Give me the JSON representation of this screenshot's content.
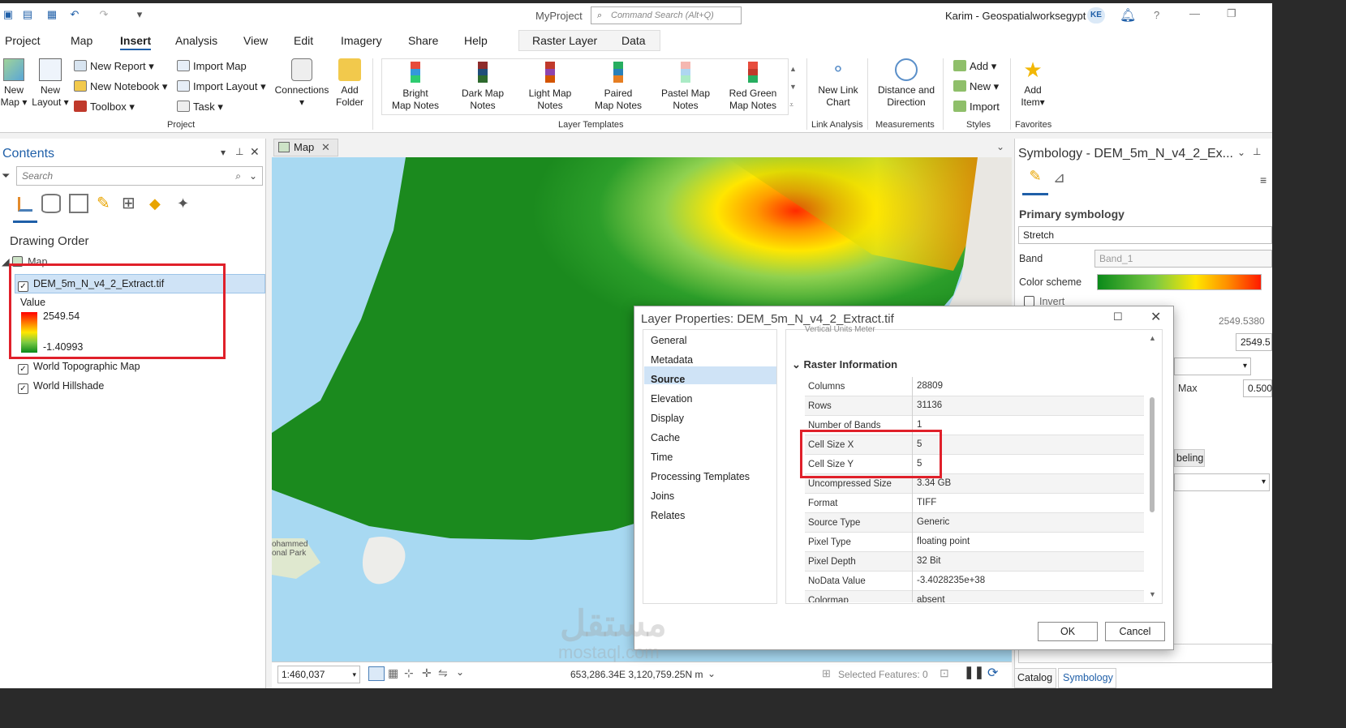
{
  "title_bar": {
    "project": "MyProject",
    "command_search_placeholder": "Command Search (Alt+Q)",
    "user": "Karim - Geospatialworksegypt",
    "user_initials": "KE",
    "help": "?"
  },
  "menu": {
    "tabs": [
      "Project",
      "Map",
      "Insert",
      "Analysis",
      "View",
      "Edit",
      "Imagery",
      "Share",
      "Help"
    ],
    "active": "Insert",
    "context_tabs": [
      "Raster Layer",
      "Data"
    ]
  },
  "ribbon": {
    "new_map": [
      "New",
      "Map"
    ],
    "new_layout": [
      "New",
      "Layout"
    ],
    "new_report": "New Report",
    "new_notebook": "New Notebook",
    "toolbox": "Toolbox",
    "import_map": "Import Map",
    "import_layout": "Import Layout",
    "task": "Task",
    "connections": "Connections",
    "add_folder": [
      "Add",
      "Folder"
    ],
    "project_group": "Project",
    "templates": [
      {
        "line1": "Bright",
        "line2": "Map Notes"
      },
      {
        "line1": "Dark Map",
        "line2": "Notes"
      },
      {
        "line1": "Light Map",
        "line2": "Notes"
      },
      {
        "line1": "Paired",
        "line2": "Map Notes"
      },
      {
        "line1": "Pastel Map",
        "line2": "Notes"
      },
      {
        "line1": "Red Green",
        "line2": "Map Notes"
      }
    ],
    "templates_group": "Layer Templates",
    "new_link_chart": [
      "New Link",
      "Chart"
    ],
    "link_analysis_group": "Link Analysis",
    "distance_direction": [
      "Distance and",
      "Direction"
    ],
    "measurements_group": "Measurements",
    "styles_add": "Add",
    "styles_new": "New",
    "styles_import": "Import",
    "styles_group": "Styles",
    "add_item": [
      "Add",
      "Item"
    ],
    "favorites_group": "Favorites"
  },
  "contents": {
    "title": "Contents",
    "search_placeholder": "Search",
    "drawing_order": "Drawing Order",
    "map_node": "Map",
    "layers": [
      {
        "name": "DEM_5m_N_v4_2_Extract.tif",
        "checked": true
      },
      {
        "name": "World Topographic Map",
        "checked": true
      },
      {
        "name": "World Hillshade",
        "checked": true
      }
    ],
    "legend": {
      "label": "Value",
      "max": "2549.54",
      "min": "-1.40993"
    }
  },
  "map": {
    "tab": "Map",
    "scale": "1:460,037",
    "coordinates": "653,286.34E 3,120,759.25N m",
    "selected_features": "Selected Features: 0",
    "place_label": [
      "ohammed",
      "onal Park"
    ]
  },
  "symbology": {
    "title": "Symbology - DEM_5m_N_v4_2_Ex...",
    "primary": "Primary symbology",
    "renderer": "Stretch",
    "band_label": "Band",
    "band_value": "Band_1",
    "color_scheme_label": "Color scheme",
    "invert": "Invert",
    "stat_value_1": "2549.5380",
    "stat_value_2": "2549.5",
    "max_label": "Max",
    "max_value": "0.500",
    "labeling_tab": "beling",
    "bottom_tabs": [
      "Catalog",
      "Symbology"
    ]
  },
  "dialog": {
    "title": "Layer Properties: DEM_5m_N_v4_2_Extract.tif",
    "nav": [
      "General",
      "Metadata",
      "Source",
      "Elevation",
      "Display",
      "Cache",
      "Time",
      "Processing Templates",
      "Joins",
      "Relates"
    ],
    "active_nav": "Source",
    "clipped_row_top": "Vertical Units   Meter",
    "section": "Raster Information",
    "rows": [
      {
        "k": "Columns",
        "v": "28809"
      },
      {
        "k": "Rows",
        "v": "31136"
      },
      {
        "k": "Number of Bands",
        "v": "1"
      },
      {
        "k": "Cell Size X",
        "v": "5"
      },
      {
        "k": "Cell Size Y",
        "v": "5"
      },
      {
        "k": "Uncompressed Size",
        "v": "3.34 GB"
      },
      {
        "k": "Format",
        "v": "TIFF"
      },
      {
        "k": "Source Type",
        "v": "Generic"
      },
      {
        "k": "Pixel Type",
        "v": "floating point"
      },
      {
        "k": "Pixel Depth",
        "v": "32 Bit"
      },
      {
        "k": "NoData Value",
        "v": "-3.4028235e+38"
      },
      {
        "k": "Colormap",
        "v": "absent"
      }
    ],
    "ok": "OK",
    "cancel": "Cancel"
  },
  "watermark": {
    "arabic": "مستقل",
    "latin": "mostaql.com"
  },
  "colors": {
    "accent": "#1f5fa8",
    "highlight_box": "#e0202a",
    "dem_low": "#0b8a1a",
    "dem_high": "#ff1a00",
    "water": "#a8d9f2"
  }
}
